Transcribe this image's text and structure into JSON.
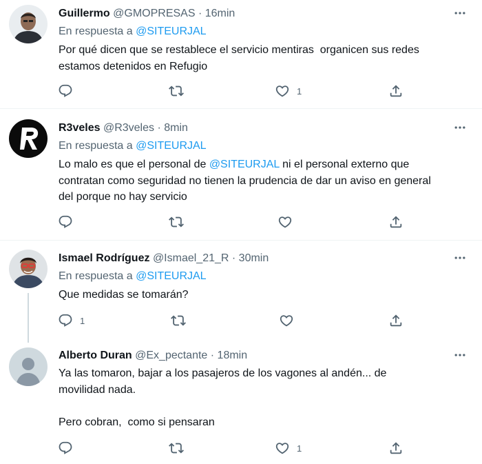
{
  "tweets": [
    {
      "name": "Guillermo",
      "handle": "@GMOPRESAS",
      "time": "· 16min",
      "reply_prefix": "En respuesta a",
      "reply_to": "@SITEURJAL",
      "text_parts": [
        "Por qué dicen que se restablece el servicio mentiras  organicen sus redes\nestamos detenidos en Refugio"
      ],
      "reply_count": "",
      "like_count": "1",
      "avatar": "man-avatar"
    },
    {
      "name": "R3veles",
      "handle": "@R3veles",
      "time": "· 8min",
      "reply_prefix": "En respuesta a",
      "reply_to": "@SITEURJAL",
      "text_parts": [
        "Lo malo es que el personal de ",
        "@SITEURJAL",
        " ni el personal externo que\ncontratan como seguridad no tienen la prudencia de dar un aviso en general\ndel porque no hay servicio"
      ],
      "reply_count": "",
      "like_count": "",
      "avatar": "r-logo-avatar"
    },
    {
      "name": "Ismael Rodríguez",
      "handle": "@Ismael_21_R",
      "time": "· 30min",
      "reply_prefix": "En respuesta a",
      "reply_to": "@SITEURJAL",
      "text_parts": [
        "Que medidas se tomarán?"
      ],
      "reply_count": "1",
      "like_count": "",
      "avatar": "man-avatar"
    },
    {
      "name": "Alberto Duran",
      "handle": "@Ex_pectante",
      "time": "· 18min",
      "text_parts": [
        "Ya las tomaron, bajar a los pasajeros de los vagones al andén... de\nmovilidad nada.\n\nPero cobran,  como si pensaran"
      ],
      "reply_count": "",
      "like_count": "1",
      "avatar": "default-profile-avatar"
    }
  ],
  "icons": {
    "reply": "reply-icon",
    "retweet": "retweet-icon",
    "like": "like-icon",
    "share": "share-icon",
    "more": "more-icon"
  },
  "colors": {
    "link": "#1d9bf0",
    "secondary": "#536471",
    "text": "#0f1419",
    "separator": "#eff3f4"
  }
}
